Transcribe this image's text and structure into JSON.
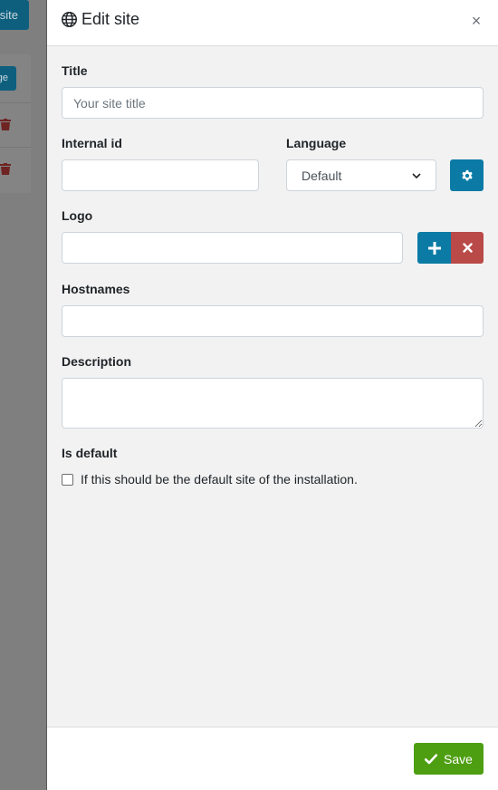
{
  "background": {
    "top_button_label": "site",
    "small_button_label": "ge"
  },
  "panel": {
    "title": "Edit site",
    "close_symbol": "×",
    "icons": {
      "title_icon": "globe-icon",
      "close_icon": "close-icon",
      "settings_icon": "gear-icon",
      "add_icon": "plus-icon",
      "remove_icon": "times-icon",
      "save_icon": "check-icon",
      "select_icon": "chevron-down-icon"
    }
  },
  "form": {
    "title": {
      "label": "Title",
      "placeholder": "Your site title",
      "value": ""
    },
    "internal_id": {
      "label": "Internal id",
      "value": ""
    },
    "language": {
      "label": "Language",
      "selected": "Default"
    },
    "logo": {
      "label": "Logo",
      "value": ""
    },
    "hostnames": {
      "label": "Hostnames",
      "value": ""
    },
    "description": {
      "label": "Description",
      "value": ""
    },
    "is_default": {
      "label": "Is default",
      "checkbox_text": "If this should be the default site of the installation.",
      "checked": false
    }
  },
  "footer": {
    "save_label": "Save"
  },
  "colors": {
    "primary": "#0b7ba6",
    "danger": "#b94a48",
    "success": "#4e9e12",
    "panel_bg": "#f2f2f2",
    "overlay": "#808080"
  }
}
